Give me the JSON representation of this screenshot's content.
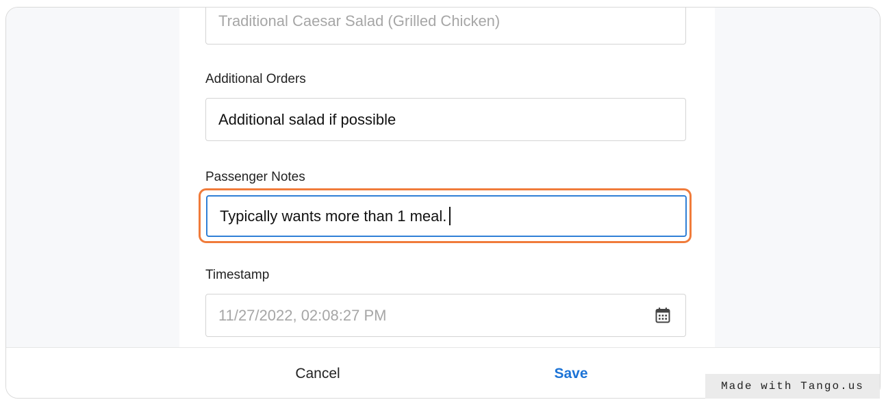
{
  "form": {
    "meal_field": {
      "value": "Traditional Caesar Salad  (Grilled Chicken)"
    },
    "additional_orders": {
      "label": "Additional Orders",
      "value": "Additional salad if possible"
    },
    "passenger_notes": {
      "label": "Passenger Notes",
      "value": "Typically wants more than 1 meal."
    },
    "timestamp": {
      "label": "Timestamp",
      "value": "11/27/2022, 02:08:27 PM",
      "icon": "calendar-icon"
    }
  },
  "footer": {
    "cancel_label": "Cancel",
    "save_label": "Save"
  },
  "watermark": {
    "text": "Made with Tango.us"
  },
  "colors": {
    "accent_blue": "#1c73d6",
    "focus_border": "#2f7fd6",
    "highlight_orange": "#f07b3a",
    "side_background": "#f7f8fa"
  }
}
